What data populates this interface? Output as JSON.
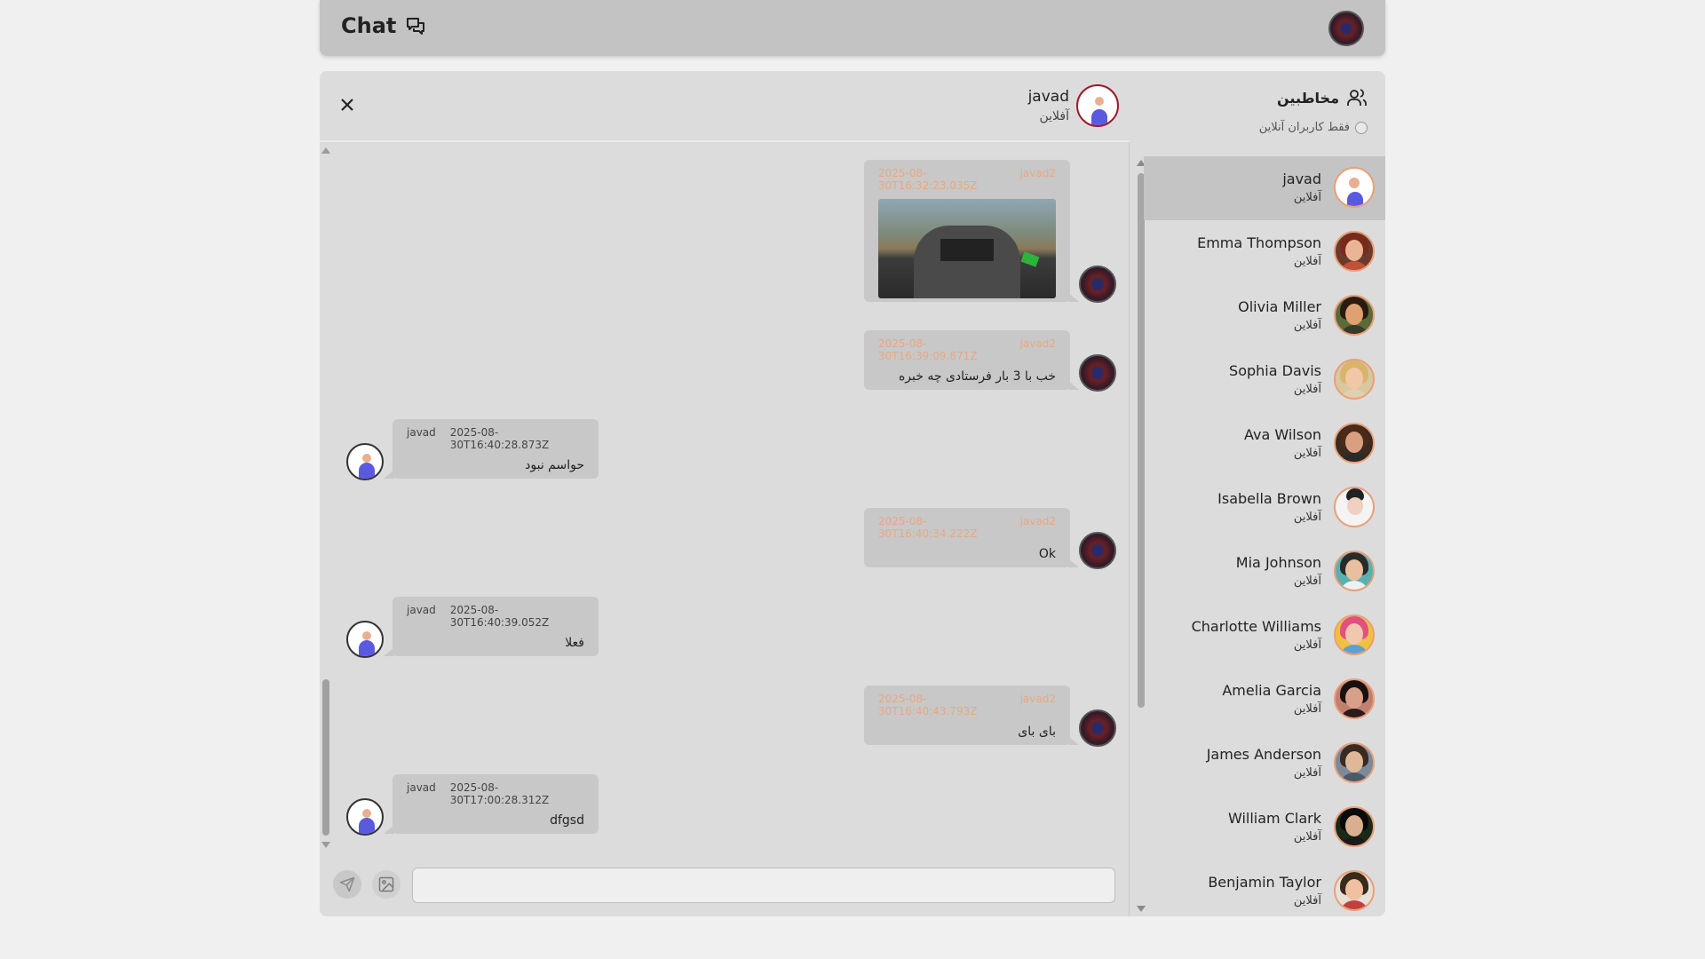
{
  "header": {
    "title": "Chat"
  },
  "chat": {
    "peer": {
      "name": "javad",
      "status": "آفلاین"
    },
    "messages": [
      {
        "side": "mine",
        "sender": "javad2",
        "time": "2025-08-30T16:32:23.035Z",
        "text": "",
        "has_image": true
      },
      {
        "side": "mine",
        "sender": "javad2",
        "time": "2025-08-30T16:39:09.871Z",
        "text": "خب با 3 بار فرستادی چه خبره"
      },
      {
        "side": "theirs",
        "sender": "javad",
        "time": "2025-08-30T16:40:28.873Z",
        "text": "حواسم نبود"
      },
      {
        "side": "mine",
        "sender": "javad2",
        "time": "2025-08-30T16:40:34.222Z",
        "text": "Ok"
      },
      {
        "side": "theirs",
        "sender": "javad",
        "time": "2025-08-30T16:40:39.052Z",
        "text": "فعلا"
      },
      {
        "side": "mine",
        "sender": "javad2",
        "time": "2025-08-30T16:40:43.793Z",
        "text": "بای بای"
      },
      {
        "side": "theirs",
        "sender": "javad",
        "time": "2025-08-30T17:00:28.312Z",
        "text": "dfgsd"
      }
    ],
    "composer": {
      "placeholder": "",
      "value": ""
    }
  },
  "contacts": {
    "title": "مخاطبین",
    "filter_label": "فقط کاربران آنلاین",
    "items": [
      {
        "name": "javad",
        "status": "آفلاین",
        "active": true
      },
      {
        "name": "Emma Thompson",
        "status": "آفلاین"
      },
      {
        "name": "Olivia Miller",
        "status": "آفلاین"
      },
      {
        "name": "Sophia Davis",
        "status": "آفلاین"
      },
      {
        "name": "Ava Wilson",
        "status": "آفلاین"
      },
      {
        "name": "Isabella Brown",
        "status": "آفلاین"
      },
      {
        "name": "Mia Johnson",
        "status": "آفلاین"
      },
      {
        "name": "Charlotte Williams",
        "status": "آفلاین"
      },
      {
        "name": "Amelia Garcia",
        "status": "آفلاین"
      },
      {
        "name": "James Anderson",
        "status": "آفلاین"
      },
      {
        "name": "William Clark",
        "status": "آفلاین"
      },
      {
        "name": "Benjamin Taylor",
        "status": "آفلاین"
      }
    ]
  },
  "colors": {
    "accent_meta_mine": "#e8a882",
    "panel": "#dcdcdc",
    "bubble": "#c8c8c8",
    "header": "#c3c3c3",
    "active_contact": "#c4c4c4"
  }
}
